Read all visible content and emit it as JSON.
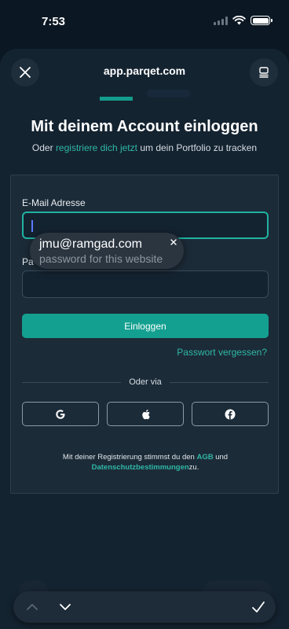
{
  "status_bar": {
    "time": "7:53",
    "icons": [
      "cellular-signal-icon",
      "wifi-icon",
      "battery-icon"
    ]
  },
  "sheet": {
    "url": "app.parqet.com",
    "close_icon": "close-icon",
    "menu_icon": "reader-menu-icon"
  },
  "page": {
    "heading": "Mit deinem Account einloggen",
    "sub_prefix": "Oder ",
    "sub_link": "registriere dich jetzt",
    "sub_suffix": " um dein Portfolio zu tracken"
  },
  "form": {
    "email_label": "E-Mail Adresse",
    "email_value": "",
    "password_label": "Pa",
    "password_value": "",
    "login_button": "Einloggen",
    "forgot_link": "Passwort vergessen?",
    "divider_text": "Oder via",
    "social": [
      "google-icon",
      "apple-icon",
      "facebook-icon"
    ]
  },
  "terms": {
    "prefix": "Mit deiner Registrierung stimmst du den ",
    "agb": "AGB",
    "and": " und",
    "privacy": "Datenschutzbestimmungen",
    "suffix": "zu."
  },
  "autofill": {
    "email": "jmu@ramgad.com",
    "hint": "password for this website"
  },
  "accessory_bar": {
    "icons": [
      "chevron-up-icon",
      "chevron-down-icon",
      "checkmark-icon"
    ]
  },
  "colors": {
    "accent": "#14a090",
    "link": "#2fb8a6",
    "background": "#0b1722",
    "card": "#1c2b38"
  }
}
